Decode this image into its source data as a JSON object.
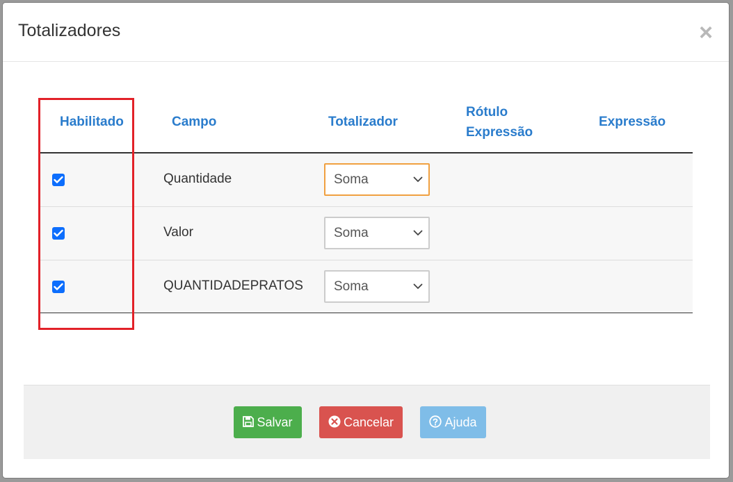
{
  "modal": {
    "title": "Totalizadores",
    "close_label": "×"
  },
  "table": {
    "headers": {
      "enabled": "Habilitado",
      "field": "Campo",
      "totalizer": "Totalizador",
      "label_line1": "Rótulo",
      "label_line2": "Expressão",
      "expression": "Expressão"
    },
    "rows": [
      {
        "enabled": true,
        "field": "Quantidade",
        "totalizer": "Soma",
        "focused": true
      },
      {
        "enabled": true,
        "field": "Valor",
        "totalizer": "Soma",
        "focused": false
      },
      {
        "enabled": true,
        "field": "QUANTIDADEPRATOS",
        "totalizer": "Soma",
        "focused": false
      }
    ]
  },
  "footer": {
    "save_label": "Salvar",
    "cancel_label": "Cancelar",
    "help_label": "Ajuda"
  },
  "icons": {
    "save": "floppy-disk-icon",
    "cancel": "times-circle-icon",
    "help": "question-circle-icon",
    "check": "checkmark-icon",
    "chevron": "chevron-down-icon"
  },
  "colors": {
    "header_text": "#2a7ccc",
    "checkbox": "#0d6efd",
    "focus_border": "#f0a040",
    "save": "#4cae4c",
    "cancel": "#d9534f",
    "help": "#7fbde8",
    "highlight": "#e22128"
  }
}
